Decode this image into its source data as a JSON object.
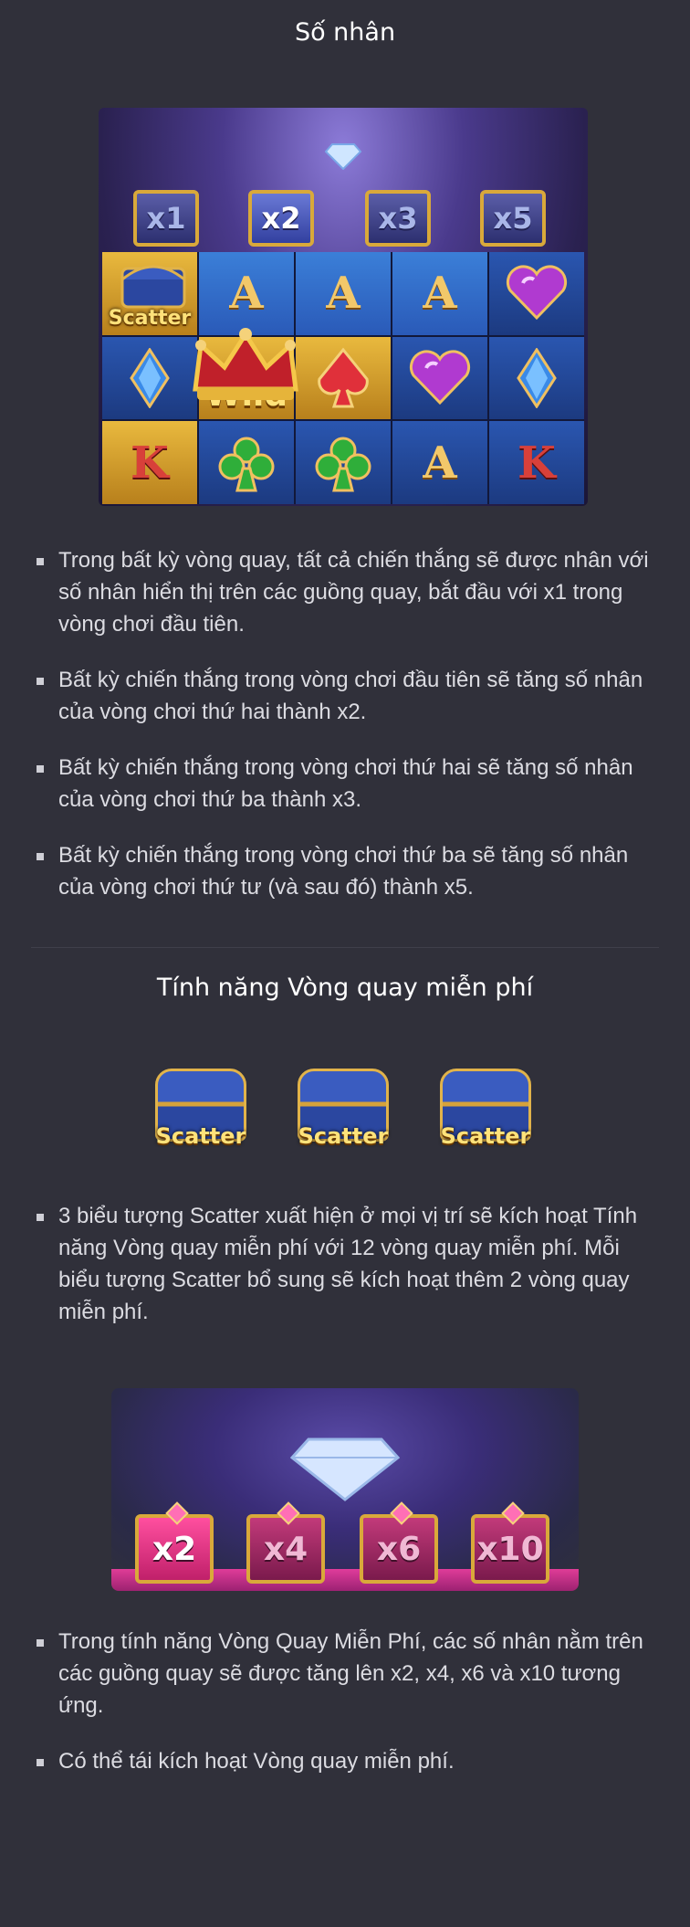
{
  "multiplier_section": {
    "title": "Số nhân",
    "reel_multipliers": [
      "x1",
      "x2",
      "x3",
      "x5"
    ],
    "active_multiplier_index": 1,
    "grid_symbols": [
      [
        "Scatter",
        "A",
        "A",
        "A",
        "heart"
      ],
      [
        "diamond",
        "Wild",
        "spade",
        "heart",
        "diamond"
      ],
      [
        "K",
        "club",
        "club",
        "A",
        "K"
      ]
    ],
    "bullets": [
      "Trong bất kỳ vòng quay, tất cả chiến thắng sẽ được nhân với số nhân hiển thị trên các guồng quay, bắt đầu với x1 trong vòng chơi đầu tiên.",
      "Bất kỳ chiến thắng trong vòng chơi đầu tiên sẽ tăng số nhân của vòng chơi thứ hai thành x2.",
      "Bất kỳ chiến thắng trong vòng chơi thứ hai sẽ tăng số nhân của vòng chơi thứ ba thành x3.",
      "Bất kỳ chiến thắng trong vòng chơi thứ ba sẽ tăng số nhân của vòng chơi thứ tư (và sau đó) thành x5."
    ]
  },
  "free_spins_section": {
    "title": "Tính năng Vòng quay miễn phí",
    "scatter_labels": [
      "Scatter",
      "Scatter",
      "Scatter"
    ],
    "bullets_1": [
      "3 biểu tượng Scatter xuất hiện ở mọi vị trí sẽ kích hoạt Tính năng Vòng quay miễn phí với 12 vòng quay miễn phí. Mỗi biểu tượng Scatter bổ sung sẽ kích hoạt thêm 2 vòng quay miễn phí."
    ],
    "free_spin_multipliers": [
      "x2",
      "x4",
      "x6",
      "x10"
    ],
    "active_free_spin_index": 0,
    "bullets_2": [
      "Trong tính năng Vòng Quay Miễn Phí, các số nhân nằm trên các guồng quay sẽ được tăng lên x2, x4, x6 và x10 tương ứng.",
      "Có thể tái kích hoạt Vòng quay miễn phí."
    ]
  },
  "colors": {
    "background": "#30303a",
    "gold": "#d9a93a",
    "reel_blue": "#2a56b0",
    "pink": "#ff4f9f"
  }
}
